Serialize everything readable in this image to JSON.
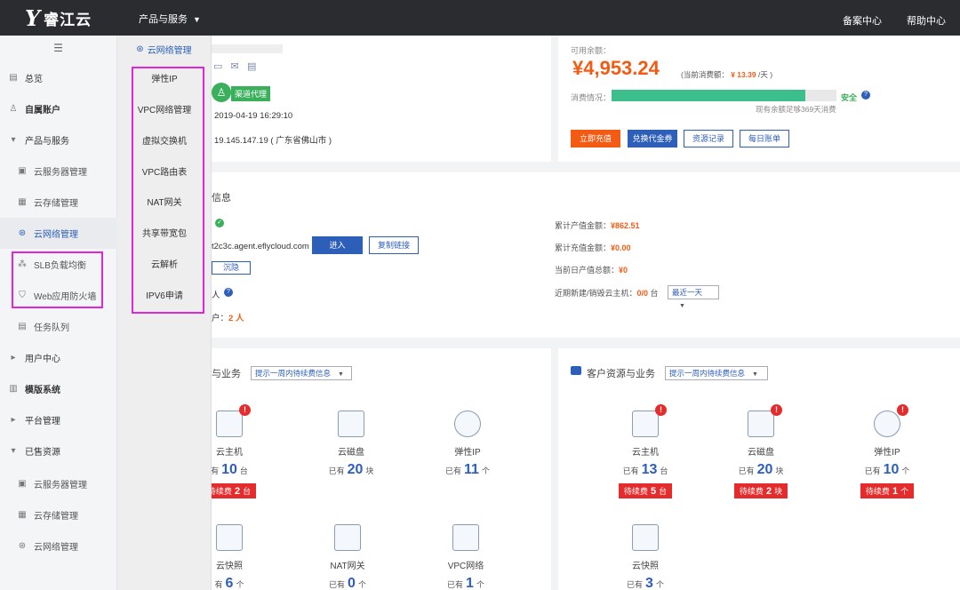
{
  "header": {
    "brand": "睿江云",
    "products_menu": "产品与服务",
    "record_center": "备案中心",
    "help_center": "帮助中心"
  },
  "sidebar": {
    "collapse_icon": "menu-fold-icon",
    "overview": "总览",
    "my_account": "自属账户",
    "products": "产品与服务",
    "cloud_server": "云服务器管理",
    "cloud_storage": "云存储管理",
    "cloud_network": "云网络管理",
    "slb": "SLB负载均衡",
    "waf": "Web应用防火墙",
    "task_queue": "任务队列",
    "user_center": "用户中心",
    "template_system": "模版系统",
    "platform_mgmt": "平台管理",
    "sold_resources": "已售资源",
    "sold_cloud_server": "云服务器管理",
    "sold_cloud_storage": "云存储管理",
    "sold_cloud_network": "云网络管理"
  },
  "submenu": {
    "title": "云网络管理",
    "items": [
      "弹性IP",
      "VPC网络管理",
      "虚拟交换机",
      "VPC路由表",
      "NAT网关",
      "共享带宽包",
      "云解析",
      "IPV6申请"
    ]
  },
  "account": {
    "badge": "渠道代理",
    "login_time": "2019-04-19 16:29:10",
    "login_ip": "19.145.147.19 ( 广东省佛山市 )"
  },
  "balance": {
    "label": "可用余额：",
    "amount": "¥4,953.24",
    "daily_label": "(当前消费额：",
    "daily_value": "¥ 13.39",
    "daily_unit": "/天 )",
    "consume_label": "消费情况：",
    "consume_status": "安全",
    "consume_fraction": 0.86,
    "remain_note": "现有余额足够369天消费",
    "btn_recharge": "立即充值",
    "btn_voucher": "兑换代金券",
    "btn_records": "资源记录",
    "btn_bill": "每日账单"
  },
  "info": {
    "title": "信息",
    "agent_domain": "t2c3c.agent.eflycloud.com",
    "btn_enter": "进入",
    "btn_copy": "复制链接",
    "btn_hide": "沉隐",
    "row_person": "人",
    "row_users_label": "户：",
    "row_users_value": "2 人",
    "total_output_label": "累计产值金额：",
    "total_output_value": "¥862.51",
    "total_recharge_label": "累计充值金额：",
    "total_recharge_value": "¥0.00",
    "today_output_label": "当前日产值总额：",
    "today_output_value": "¥0",
    "recent_hosts_label": "近期新建/销毁云主机：",
    "recent_hosts_value": "0/0",
    "recent_hosts_unit": "台",
    "recent_select": "最近一天"
  },
  "own_resources": {
    "title": "与业务",
    "filter": "提示一周内待续费信息",
    "items": [
      {
        "name": "云主机",
        "count_prefix": "有",
        "count": "10",
        "unit": "台",
        "pending_prefix": "待续费",
        "pending": "2",
        "pending_unit": "台",
        "alert": true
      },
      {
        "name": "云磁盘",
        "count_prefix": "已有",
        "count": "20",
        "unit": "块",
        "alert": false
      },
      {
        "name": "弹性IP",
        "count_prefix": "已有",
        "count": "11",
        "unit": "个",
        "alert": false
      },
      {
        "name": "云快照",
        "count_prefix": "有",
        "count": "6",
        "unit": "个",
        "alert": false
      },
      {
        "name": "NAT网关",
        "count_prefix": "已有",
        "count": "0",
        "unit": "个",
        "alert": false
      },
      {
        "name": "VPC网络",
        "count_prefix": "已有",
        "count": "1",
        "unit": "个",
        "alert": false
      }
    ]
  },
  "client_resources": {
    "title": "客户资源与业务",
    "filter": "提示一周内待续费信息",
    "items": [
      {
        "name": "云主机",
        "count_prefix": "已有",
        "count": "13",
        "unit": "台",
        "pending_prefix": "待续费",
        "pending": "5",
        "pending_unit": "台",
        "alert": true
      },
      {
        "name": "云磁盘",
        "count_prefix": "已有",
        "count": "20",
        "unit": "块",
        "pending_prefix": "待续费",
        "pending": "2",
        "pending_unit": "块",
        "alert": true
      },
      {
        "name": "弹性IP",
        "count_prefix": "已有",
        "count": "10",
        "unit": "个",
        "pending_prefix": "待续费",
        "pending": "1",
        "pending_unit": "个",
        "alert": true
      },
      {
        "name": "云快照",
        "count_prefix": "已有",
        "count": "3",
        "unit": "个",
        "alert": false
      }
    ]
  },
  "colors": {
    "accent": "#2d5fb9",
    "orange": "#f35b14",
    "danger": "#e52b2b",
    "highlight": "#e026d8",
    "success": "#3dbf8d"
  }
}
